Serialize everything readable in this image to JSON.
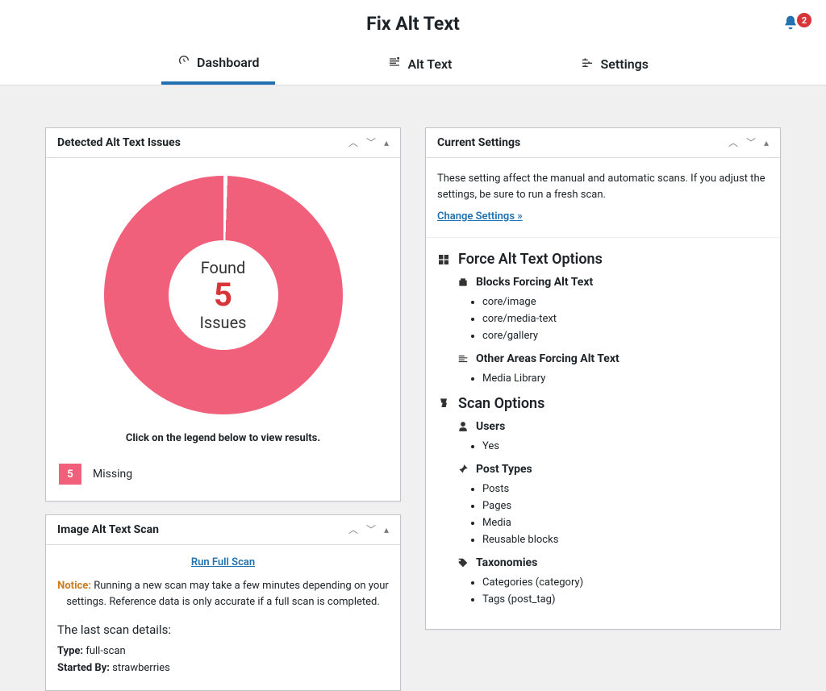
{
  "app": {
    "title": "Fix Alt Text"
  },
  "notifications": {
    "count": "2"
  },
  "tabs": {
    "dashboard": "Dashboard",
    "alttext": "Alt Text",
    "settings": "Settings"
  },
  "issues_card": {
    "title": "Detected Alt Text Issues",
    "found_label": "Found",
    "count": "5",
    "issues_label": "Issues",
    "legend_hint": "Click on the legend below to view results.",
    "legend_count": "5",
    "legend_label": "Missing"
  },
  "scan_card": {
    "title": "Image Alt Text Scan",
    "run_full_scan": "Run Full Scan",
    "notice_label": "Notice:",
    "notice_text": " Running a new scan may take a few minutes depending on your settings. Reference data is only accurate if a full scan is completed.",
    "last_scan_heading": "The last scan details:",
    "type_label": "Type:",
    "type_value": " full-scan",
    "started_by_label": "Started By:",
    "started_by_value": " strawberries"
  },
  "settings_card": {
    "title": "Current Settings",
    "desc": "These setting affect the manual and automatic scans. If you adjust the settings, be sure to run a fresh scan.",
    "change_link": "Change Settings »",
    "force_heading": "Force Alt Text Options",
    "blocks_heading": "Blocks Forcing Alt Text",
    "blocks": {
      "0": "core/image",
      "1": "core/media-text",
      "2": "core/gallery"
    },
    "other_heading": "Other Areas Forcing Alt Text",
    "other": {
      "0": "Media Library"
    },
    "scan_heading": "Scan Options",
    "users_heading": "Users",
    "users": {
      "0": "Yes"
    },
    "post_types_heading": "Post Types",
    "post_types": {
      "0": "Posts",
      "1": "Pages",
      "2": "Media",
      "3": "Reusable blocks"
    },
    "tax_heading": "Taxonomies",
    "tax": {
      "0": "Categories (category)",
      "1": "Tags (post_tag)"
    }
  },
  "chart_data": {
    "type": "pie",
    "title": "Detected Alt Text Issues",
    "series": [
      {
        "name": "Missing",
        "value": 5,
        "color": "#f1607b"
      }
    ],
    "total": 5,
    "center_labels": [
      "Found",
      "5",
      "Issues"
    ]
  }
}
